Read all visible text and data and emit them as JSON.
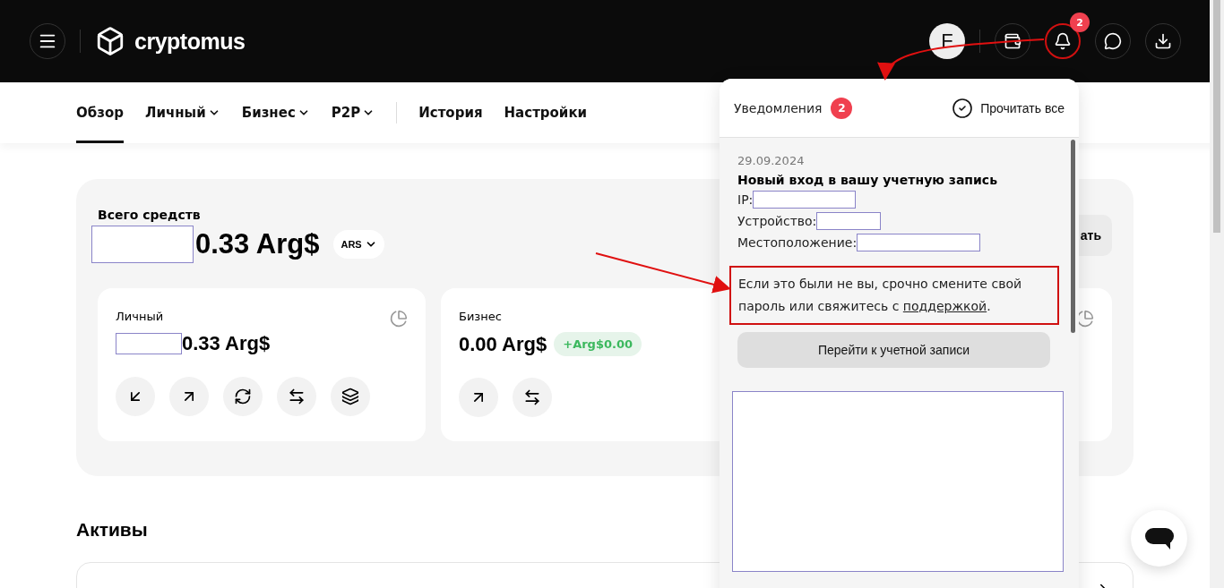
{
  "header": {
    "logo": "cryptomus",
    "avatar": "F",
    "bell_badge": "2"
  },
  "nav": {
    "items": [
      {
        "label": "Обзор",
        "dropdown": false,
        "selected": true
      },
      {
        "label": "Личный",
        "dropdown": true,
        "selected": false
      },
      {
        "label": "Бизнес",
        "dropdown": true,
        "selected": false
      },
      {
        "label": "P2P",
        "dropdown": true,
        "selected": false
      }
    ],
    "links": [
      {
        "label": "История"
      },
      {
        "label": "Настройки"
      }
    ]
  },
  "summary": {
    "title": "Всего средств",
    "amount": "0.33 Arg$",
    "currency": "ARS",
    "action_text": "ать"
  },
  "wallets": [
    {
      "name": "Личный",
      "amount": "0.33 Arg$",
      "redacted": true,
      "actions": [
        {
          "kind": "receive"
        },
        {
          "kind": "send"
        },
        {
          "kind": "exchange"
        },
        {
          "kind": "transfer"
        },
        {
          "kind": "stake"
        }
      ]
    },
    {
      "name": "Бизнес",
      "amount": "0.00 Arg$",
      "redacted": false,
      "change": "+Arg$0.00",
      "actions": [
        {
          "kind": "send"
        },
        {
          "kind": "transfer"
        }
      ]
    }
  ],
  "assets": {
    "title": "Активы"
  },
  "notifications": {
    "title": "Уведомления",
    "count": "2",
    "read_all": "Прочитать все",
    "items": [
      {
        "date": "29.09.2024",
        "title": "Новый вход в вашу учетную запись",
        "fields": [
          {
            "label": "IP:"
          },
          {
            "label": "Устройство:"
          },
          {
            "label": "Местоположение:"
          }
        ],
        "warning": {
          "before": "Если это были не вы, срочно смените свой пароль или свяжитесь с ",
          "link": "поддержкой",
          "after": "."
        },
        "button": "Перейти к учетной записи"
      }
    ]
  }
}
